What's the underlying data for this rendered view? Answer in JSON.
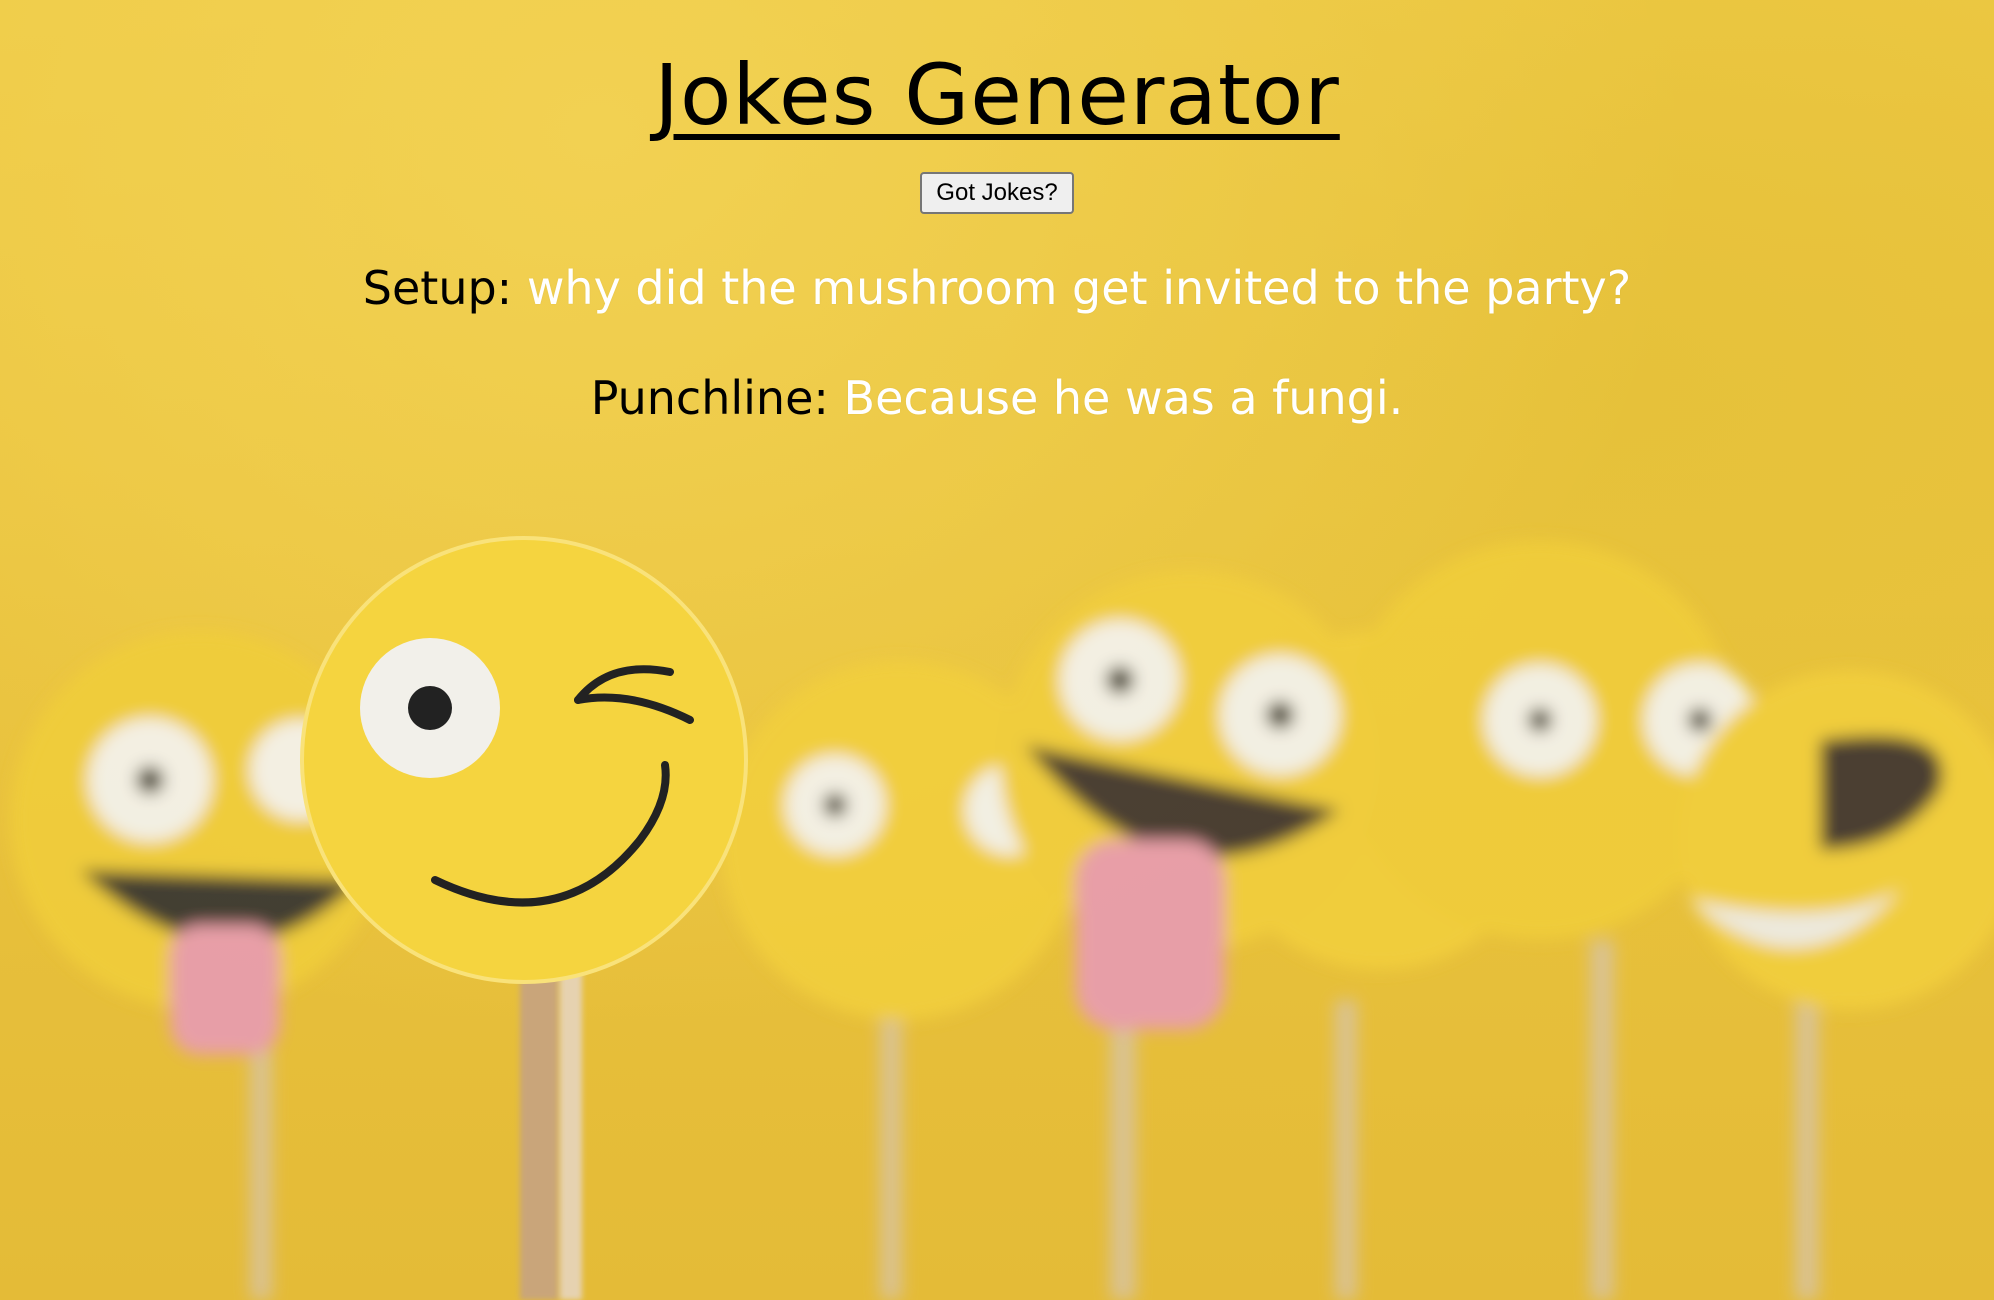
{
  "title": "Jokes Generator",
  "button_label": "Got Jokes?",
  "setup": {
    "label": "Setup:",
    "text": "why did the mushroom get invited to the party?"
  },
  "punchline": {
    "label": "Punchline:",
    "text": "Because he was a fungi."
  },
  "colors": {
    "background": "#ecc63f",
    "label": "#000000",
    "value": "#ffffff"
  }
}
